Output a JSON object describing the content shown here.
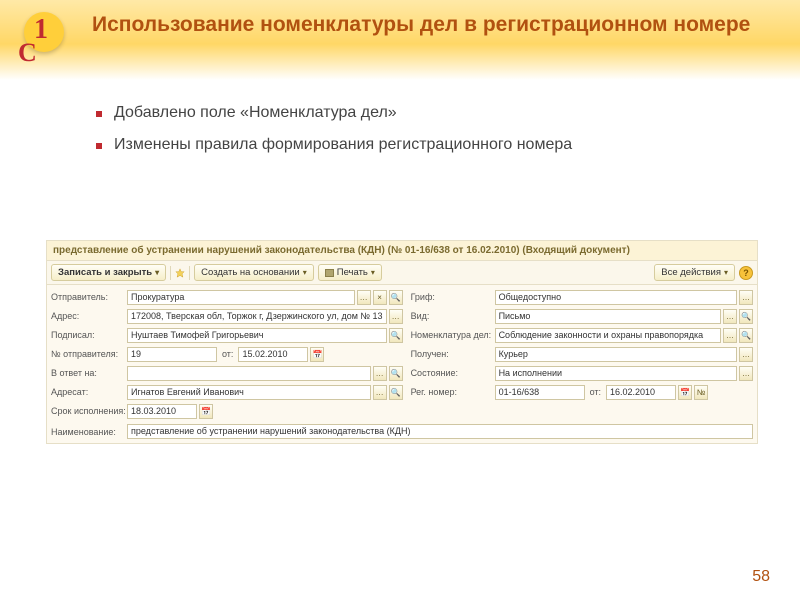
{
  "slide": {
    "title": "Использование номенклатуры дел в регистрационном номере",
    "bullets": [
      "Добавлено поле «Номенклатура дел»",
      "Изменены правила формирования регистрационного номера"
    ],
    "page": "58"
  },
  "form": {
    "title": "представление об устранении нарушений законодательства (КДН) (№ 01-16/638 от 16.02.2010) (Входящий документ)",
    "toolbar": {
      "save_close": "Записать и закрыть",
      "create_based": "Создать на основании",
      "print": "Печать",
      "all_actions": "Все действия"
    },
    "left": {
      "sender_label": "Отправитель:",
      "sender": "Прокуратура",
      "address_label": "Адрес:",
      "address": "172008, Тверская обл, Торжок г, Дзержинского ул, дом № 13",
      "signed_label": "Подписал:",
      "signed": "Нуштаев Тимофей Григорьевич",
      "sender_no_label": "№ отправителя:",
      "sender_no": "19",
      "sender_date_label": "от:",
      "sender_date": "15.02.2010",
      "reply_label": "В ответ на:",
      "reply": "",
      "addressee_label": "Адресат:",
      "addressee": "Игнатов Евгений Иванович",
      "deadline_label": "Срок исполнения:",
      "deadline": "18.03.2010"
    },
    "right": {
      "grif_label": "Гриф:",
      "grif": "Общедоступно",
      "kind_label": "Вид:",
      "kind": "Письмо",
      "nomenclature_label": "Номенклатура дел:",
      "nomenclature": "Соблюдение законности и охраны правопорядка",
      "received_label": "Получен:",
      "received": "Курьер",
      "state_label": "Состояние:",
      "state": "На исполнении",
      "reg_no_label": "Рег. номер:",
      "reg_no": "01-16/638",
      "reg_date_label": "от:",
      "reg_date": "16.02.2010"
    },
    "bottom": {
      "name_label": "Наименование:",
      "name": "представление об устранении нарушений законодательства (КДН)"
    }
  }
}
